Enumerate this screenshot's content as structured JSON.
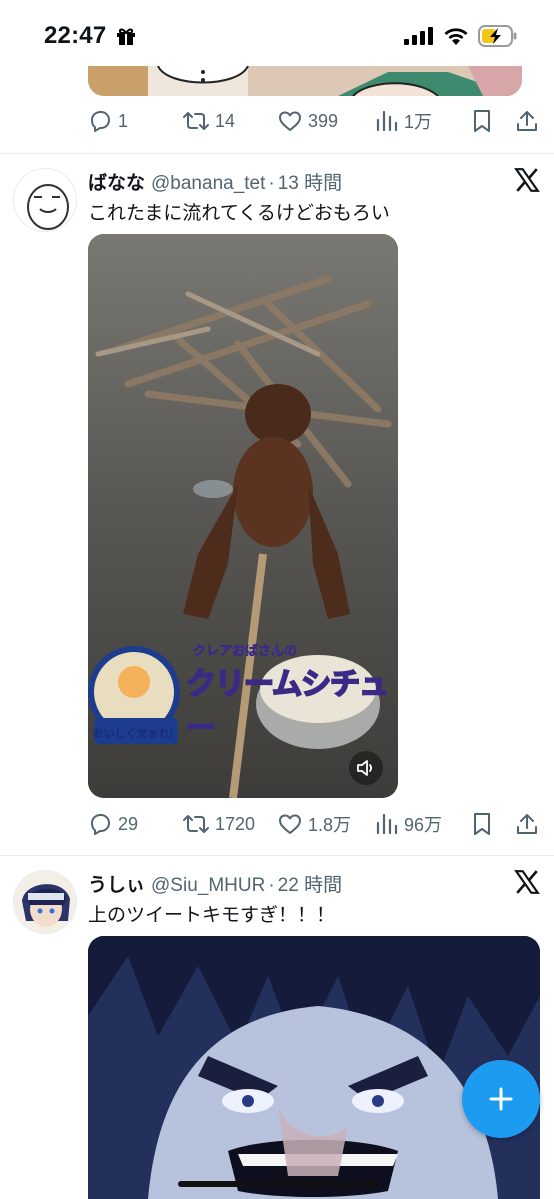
{
  "status_bar": {
    "time": "22:47",
    "icons": [
      "gift-icon",
      "signal-icon",
      "wifi-icon",
      "battery-charging-icon"
    ]
  },
  "previous_tweet": {
    "actions": {
      "replies": "1",
      "retweets": "14",
      "likes": "399",
      "views": "1万"
    }
  },
  "tweets": [
    {
      "name": "ばなな",
      "handle": "@banana_tet",
      "separator": "·",
      "time": "13 時間",
      "text": "これたまに流れてくるけどおもろい",
      "media_overlay": {
        "ad_subtitle": "クレアおばさんの",
        "ad_title": "クリームシチュー",
        "badge_text": "おいしく女ぁれ!"
      },
      "actions": {
        "replies": "29",
        "retweets": "1720",
        "likes": "1.8万",
        "views": "96万"
      }
    },
    {
      "name": "うしぃ",
      "handle": "@Siu_MHUR",
      "separator": "·",
      "time": "22 時間",
      "text": "上のツイートキモすぎ！！！"
    }
  ],
  "colors": {
    "accent": "#1d9bf0",
    "text_primary": "#0f1419",
    "text_secondary": "#536471",
    "divider": "#e6ecf0"
  }
}
